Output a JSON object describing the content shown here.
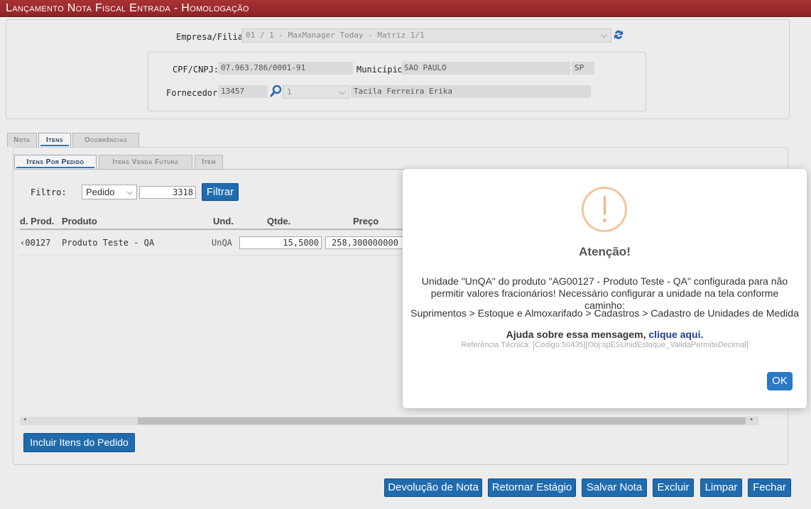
{
  "window": {
    "title": "Lançamento Nota Fiscal Entrada  - Homologação"
  },
  "header": {
    "empresa_label": "Empresa/Filial:",
    "empresa_value": "01 / 1 - MaxManager Today - Matriz 1/1",
    "cpf_label": "CPF/CNPJ:",
    "cpf_value": "07.963.786/0001-91",
    "municipio_label": "Município:",
    "municipio_value": "SAO PAULO",
    "uf_value": "SP",
    "fornecedor_label": "Fornecedor:",
    "fornecedor_code": "13457",
    "fornecedor_seq": "1",
    "fornecedor_name": "Tacila Ferreira Erika"
  },
  "main_tabs": [
    {
      "label": "Nota"
    },
    {
      "label": "Itens"
    },
    {
      "label": "Ocorrências"
    }
  ],
  "sub_tabs": [
    {
      "label": "Itens Por Pedido"
    },
    {
      "label": "Itens Venda Futura"
    },
    {
      "label": "Item"
    }
  ],
  "filter": {
    "label": "Filtro:",
    "type_value": "Pedido",
    "number_value": "3318",
    "button_label": "Filtrar"
  },
  "grid": {
    "columns": [
      "d. Prod.",
      "Produto",
      "Und.",
      "Qtde.",
      "Preço"
    ],
    "rows": [
      {
        "codigo": "‹00127",
        "produto": "Produto Teste - QA",
        "und": "UnQA",
        "qtde": "15,5000",
        "preco": "258,300000000"
      }
    ]
  },
  "incluir_button": "Incluir Itens do Pedido",
  "footer_buttons": [
    "Devolução de Nota",
    "Retornar Estágio",
    "Salvar Nota",
    "Excluir",
    "Limpar",
    "Fechar"
  ],
  "dialog": {
    "title": "Atenção!",
    "message_line1": "Unidade \"UnQA\" do produto \"AG00127 - Produto Teste - QA\" configurada para não",
    "message_line2": "permitir valores fracionários! Necessário configurar a unidade na tela conforme caminho:",
    "path": "Suprimentos > Estoque e Almoxarifado > Cadastros > Cadastro de Unidades de Medida",
    "help_text": "Ajuda sobre essa mensagem,",
    "help_link": "clique aqui.",
    "reference": "Referência Técnica: [Código:50435][Obj:spESUnidEstoque_ValidaPermiteDecimal]",
    "ok_label": "OK"
  },
  "colors": {
    "titlebar": "#a83234",
    "primary_button": "#1f6bae",
    "warning": "#f3b48a"
  }
}
